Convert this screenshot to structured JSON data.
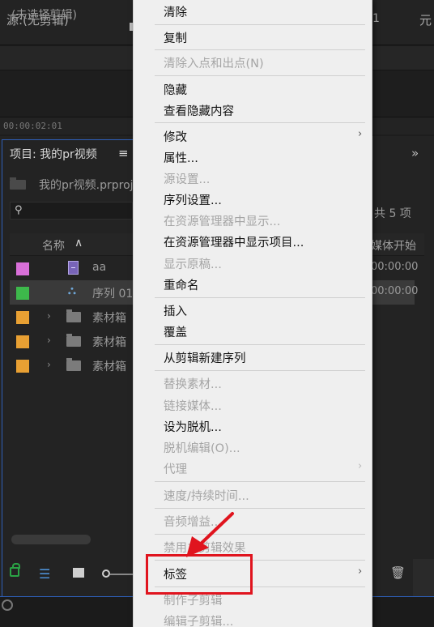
{
  "source_panel": {
    "title": "源:(无剪辑)",
    "right_fragment_1": "1",
    "right_fragment_2": "元",
    "subheader": "(未选择剪辑)",
    "timecode": "00:00:02:01"
  },
  "project_panel": {
    "tab_label": "项目: 我的pr视频",
    "tab_menu": "≡",
    "expand": "»",
    "path": "我的pr视频.prproj",
    "item_count": "共 5 项",
    "columns": {
      "name": "名称",
      "sort": "∧",
      "start": "媒体开始"
    },
    "rows": [
      {
        "color": "#d86fd8",
        "label": "aa",
        "start": "00:00:00",
        "type": "clip",
        "selected": false
      },
      {
        "color": "#3db84b",
        "label": "序列 01",
        "start": "00:00:00",
        "type": "sequence",
        "selected": true
      },
      {
        "color": "#e8a033",
        "label": "素材箱",
        "start": "",
        "type": "bin",
        "selected": false
      },
      {
        "color": "#e8a033",
        "label": "素材箱",
        "start": "",
        "type": "bin",
        "selected": false
      },
      {
        "color": "#e8a033",
        "label": "素材箱",
        "start": "",
        "type": "bin",
        "selected": false
      }
    ]
  },
  "icons": {
    "search": "⚲",
    "list_view": "☰",
    "trash": "🗑",
    "chevron_right": "›",
    "seq": "⛬"
  },
  "context_menu": {
    "items": {
      "clear": "清除",
      "copy": "复制",
      "clear_in_out": "清除入点和出点(N)",
      "hide": "隐藏",
      "view_hidden": "查看隐藏内容",
      "modify": "修改",
      "properties": "属性...",
      "source_settings": "源设置...",
      "sequence_settings": "序列设置...",
      "reveal_in_explorer": "在资源管理器中显示...",
      "reveal_project_in_explorer": "在资源管理器中显示项目...",
      "show_original": "显示原稿...",
      "rename": "重命名",
      "insert": "插入",
      "overwrite": "覆盖",
      "new_sequence_from_clip": "从剪辑新建序列",
      "replace_footage": "替换素材...",
      "link_media": "链接媒体...",
      "make_offline": "设为脱机...",
      "edit_offline": "脱机编辑(O)...",
      "proxy": "代理",
      "speed_duration": "速度/持续时间...",
      "audio_gain": "音频增益...",
      "disable_master_clip_effects": "禁用主剪辑效果",
      "label": "标签",
      "make_subclip": "制作子剪辑",
      "edit_subclip": "编辑子剪辑..."
    }
  },
  "annotation": {
    "highlight_color": "#e0141e"
  }
}
